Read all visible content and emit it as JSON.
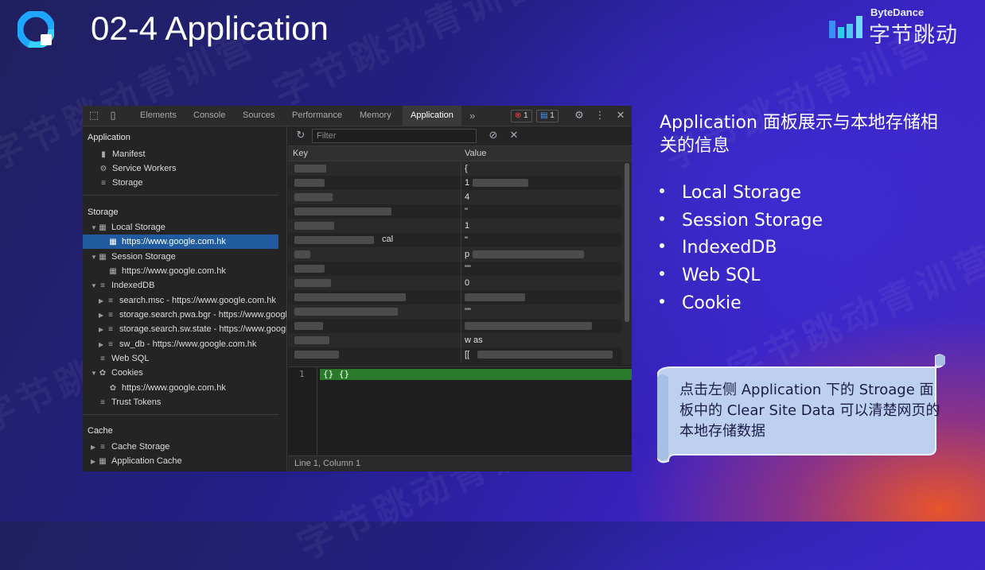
{
  "slide": {
    "title": "02-4 Application",
    "brand_sub": "ByteDance",
    "brand_main": "字节跳动",
    "watermark": "字节跳动青训营",
    "description": "Application 面板展示与本地存储相关的信息",
    "bullets": [
      "Local Storage",
      "Session Storage",
      "IndexedDB",
      "Web SQL",
      "Cookie"
    ],
    "note": "点击左侧 Application 下的 Stroage 面板中的 Clear Site Data 可以清楚网页的本地存储数据"
  },
  "devtools": {
    "tabs": [
      "Elements",
      "Console",
      "Sources",
      "Performance",
      "Memory",
      "Application"
    ],
    "active_tab": "Application",
    "more_tabs": "»",
    "error_count": "1",
    "message_count": "1",
    "sidebar": {
      "application_header": "Application",
      "application_items": [
        "Manifest",
        "Service Workers",
        "Storage"
      ],
      "storage_header": "Storage",
      "local_storage": "Local Storage",
      "local_storage_origin": "https://www.google.com.hk",
      "session_storage": "Session Storage",
      "session_storage_origin": "https://www.google.com.hk",
      "indexeddb": "IndexedDB",
      "indexeddb_items": [
        "search.msc - https://www.google.com.hk",
        "storage.search.pwa.bgr - https://www.google.com.hk",
        "storage.search.sw.state - https://www.google.com.hk",
        "sw_db - https://www.google.com.hk"
      ],
      "web_sql": "Web SQL",
      "cookies": "Cookies",
      "cookies_origin": "https://www.google.com.hk",
      "trust_tokens": "Trust Tokens",
      "cache_header": "Cache",
      "cache_storage": "Cache Storage",
      "application_cache": "Application Cache"
    },
    "filter_placeholder": "Filter",
    "columns": {
      "key": "Key",
      "value": "Value"
    },
    "rows": [
      {
        "key": "",
        "value": "{"
      },
      {
        "key": "",
        "value": "1"
      },
      {
        "key": "",
        "value": "4"
      },
      {
        "key": "",
        "value": "\""
      },
      {
        "key": "",
        "value": "1"
      },
      {
        "key": "cal",
        "value": "\""
      },
      {
        "key": "",
        "value": "p"
      },
      {
        "key": "",
        "value": "\"\""
      },
      {
        "key": "",
        "value": "0"
      },
      {
        "key": "",
        "value": ""
      },
      {
        "key": "",
        "value": "\"\""
      },
      {
        "key": "",
        "value": ""
      },
      {
        "key": "",
        "value": "w           as"
      },
      {
        "key": "",
        "value": "[["
      }
    ],
    "preview_line_number": "1",
    "preview_text": "{}  {}",
    "status": "Line 1, Column 1"
  },
  "colors": {
    "selection": "#1f5b9e",
    "preview_highlight": "#2b7a2b",
    "note_bg": "#bcd0ec"
  }
}
